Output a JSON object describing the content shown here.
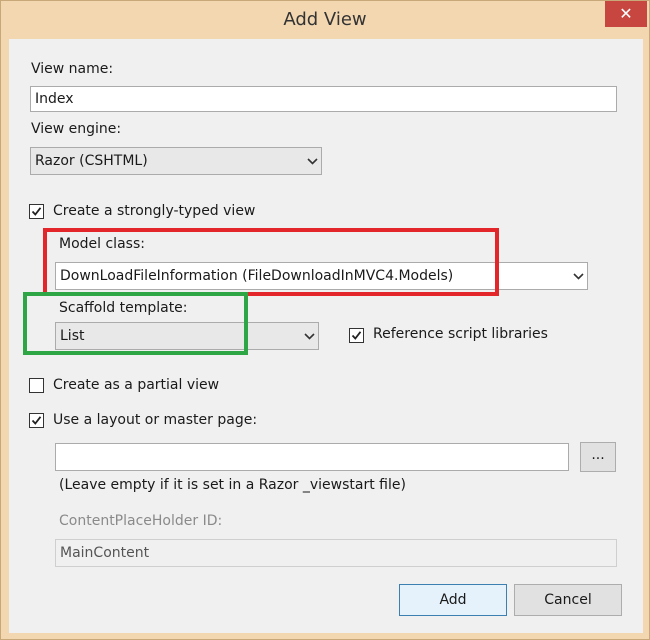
{
  "dialog": {
    "title": "Add View",
    "close_glyph": "✕"
  },
  "view_name": {
    "label": "View name:",
    "value": "Index"
  },
  "view_engine": {
    "label": "View engine:",
    "value": "Razor (CSHTML)"
  },
  "strongly_typed": {
    "label": "Create a strongly-typed view",
    "checked": true
  },
  "model_class": {
    "label": "Model class:",
    "value": "DownLoadFileInformation (FileDownloadInMVC4.Models)"
  },
  "scaffold": {
    "label": "Scaffold template:",
    "value": "List"
  },
  "reference_scripts": {
    "label": "Reference script libraries",
    "checked": true
  },
  "partial_view": {
    "label": "Create as a partial view",
    "checked": false
  },
  "layout": {
    "label": "Use a layout or master page:",
    "checked": true,
    "value": "",
    "browse_label": "...",
    "hint": "(Leave empty if it is set in a Razor _viewstart file)"
  },
  "placeholder_id": {
    "label": "ContentPlaceHolder ID:",
    "value": "MainContent"
  },
  "buttons": {
    "add": "Add",
    "cancel": "Cancel"
  },
  "annotation_colors": {
    "model_highlight": "#e3262a",
    "scaffold_highlight": "#2ea646"
  }
}
